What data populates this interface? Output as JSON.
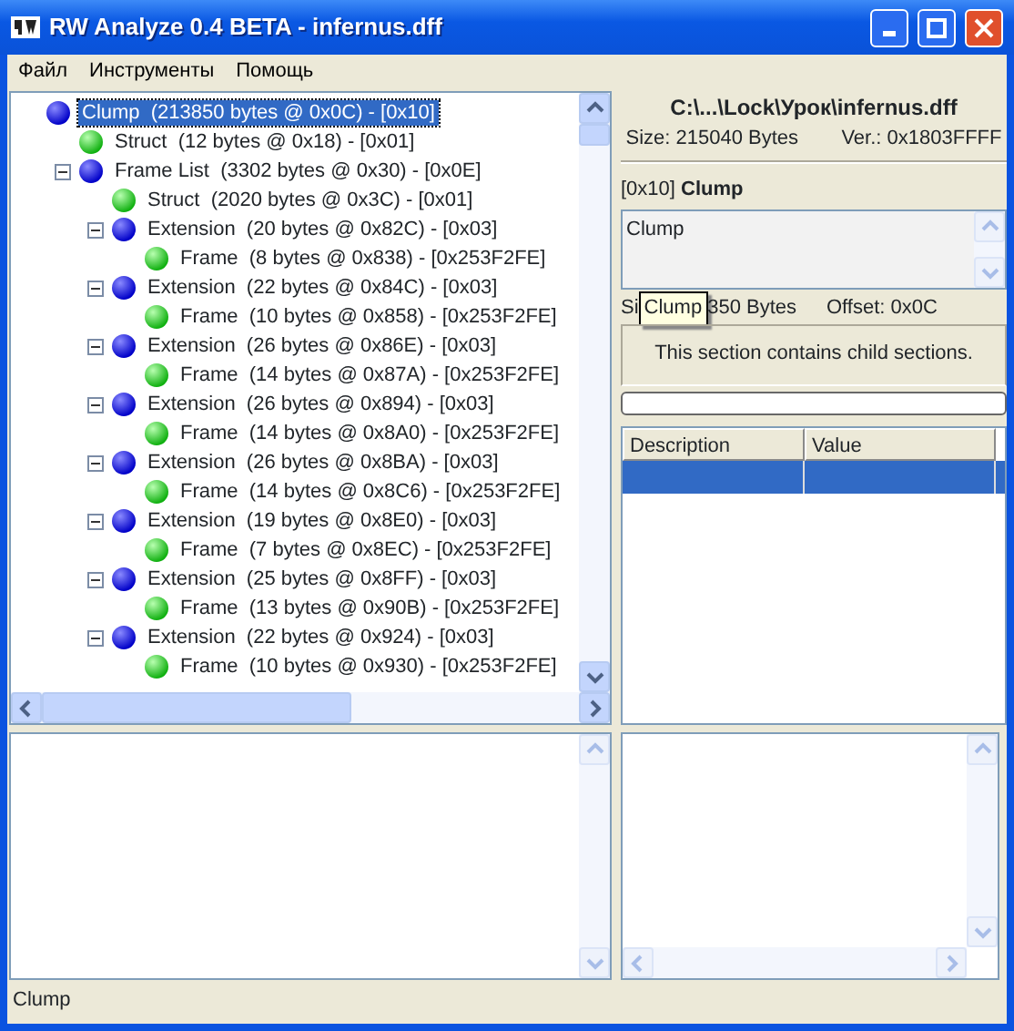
{
  "window": {
    "title": "RW Analyze 0.4 BETA - infernus.dff"
  },
  "menu": [
    {
      "label": "Файл"
    },
    {
      "label": "Инструменты"
    },
    {
      "label": "Помощь"
    }
  ],
  "tree": [
    {
      "label": "Clump  (213850 bytes @ 0x0C) - [0x10]",
      "kind": "container",
      "selected": true,
      "children": [
        {
          "label": "Struct  (12 bytes @ 0x18) - [0x01]",
          "kind": "data",
          "selected": false
        },
        {
          "label": "Frame List  (3302 bytes @ 0x30) - [0x0E]",
          "kind": "container",
          "selected": false,
          "expanded": true,
          "children": [
            {
              "label": "Struct  (2020 bytes @ 0x3C) - [0x01]",
              "kind": "data",
              "selected": false
            },
            {
              "label": "Extension  (20 bytes @ 0x82C) - [0x03]",
              "kind": "container",
              "selected": false,
              "expanded": true,
              "children": [
                {
                  "label": "Frame  (8 bytes @ 0x838) - [0x253F2FE]",
                  "kind": "data",
                  "selected": false
                }
              ]
            },
            {
              "label": "Extension  (22 bytes @ 0x84C) - [0x03]",
              "kind": "container",
              "selected": false,
              "expanded": true,
              "children": [
                {
                  "label": "Frame  (10 bytes @ 0x858) - [0x253F2FE]",
                  "kind": "data",
                  "selected": false
                }
              ]
            },
            {
              "label": "Extension  (26 bytes @ 0x86E) - [0x03]",
              "kind": "container",
              "selected": false,
              "expanded": true,
              "children": [
                {
                  "label": "Frame  (14 bytes @ 0x87A) - [0x253F2FE]",
                  "kind": "data",
                  "selected": false
                }
              ]
            },
            {
              "label": "Extension  (26 bytes @ 0x894) - [0x03]",
              "kind": "container",
              "selected": false,
              "expanded": true,
              "children": [
                {
                  "label": "Frame  (14 bytes @ 0x8A0) - [0x253F2FE]",
                  "kind": "data",
                  "selected": false
                }
              ]
            },
            {
              "label": "Extension  (26 bytes @ 0x8BA) - [0x03]",
              "kind": "container",
              "selected": false,
              "expanded": true,
              "children": [
                {
                  "label": "Frame  (14 bytes @ 0x8C6) - [0x253F2FE]",
                  "kind": "data",
                  "selected": false
                }
              ]
            },
            {
              "label": "Extension  (19 bytes @ 0x8E0) - [0x03]",
              "kind": "container",
              "selected": false,
              "expanded": true,
              "children": [
                {
                  "label": "Frame  (7 bytes @ 0x8EC) - [0x253F2FE]",
                  "kind": "data",
                  "selected": false
                }
              ]
            },
            {
              "label": "Extension  (25 bytes @ 0x8FF) - [0x03]",
              "kind": "container",
              "selected": false,
              "expanded": true,
              "children": [
                {
                  "label": "Frame  (13 bytes @ 0x90B) - [0x253F2FE]",
                  "kind": "data",
                  "selected": false
                }
              ]
            },
            {
              "label": "Extension  (22 bytes @ 0x924) - [0x03]",
              "kind": "container",
              "selected": false,
              "expanded": true,
              "children": [
                {
                  "label": "Frame  (10 bytes @ 0x930) - [0x253F2FE]",
                  "kind": "data",
                  "selected": false
                }
              ]
            }
          ]
        }
      ]
    }
  ],
  "file_info": {
    "path": "C:\\...\\Lock\\Урок\\infernus.dff",
    "size": "Size: 215040 Bytes",
    "version": "Ver.: 0x1803FFFF"
  },
  "section": {
    "heading": "[0x10] **Clump**",
    "name_text": "Clump",
    "size_parts": [
      "Si",
      "350 Bytes"
    ],
    "offset": "Offset: 0x0C",
    "tooltip": "Clump",
    "info": "This section contains child sections.",
    "progress": {
      "level": 0
    }
  },
  "table": {
    "columns": [
      "Description",
      "Value"
    ],
    "rows": [
      {
        "selected": true
      }
    ]
  },
  "status_bar": "Clump"
}
